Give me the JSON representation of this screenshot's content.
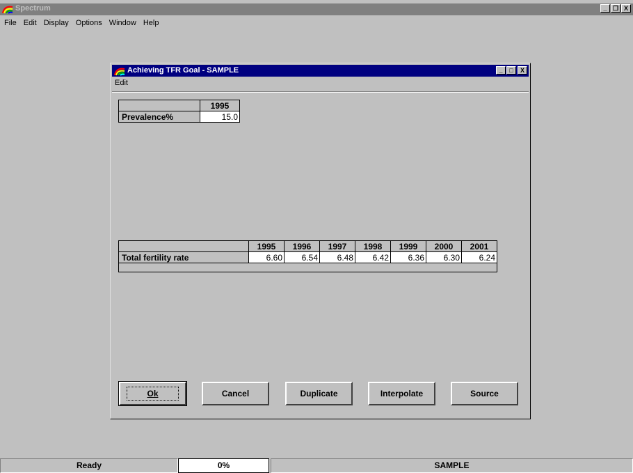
{
  "app": {
    "title": "Spectrum",
    "menu": [
      "File",
      "Edit",
      "Display",
      "Options",
      "Window",
      "Help"
    ],
    "controls": [
      "_",
      "❐",
      "X"
    ]
  },
  "dialog": {
    "title": "Achieving TFR Goal - SAMPLE",
    "menu": "Edit",
    "controls": [
      "_",
      "□",
      "X"
    ],
    "prevalence": {
      "year": "1995",
      "label": "Prevalence%",
      "value": "15.0"
    },
    "tfr": {
      "years": [
        "1995",
        "1996",
        "1997",
        "1998",
        "1999",
        "2000",
        "2001"
      ],
      "label": "Total fertility rate",
      "values": [
        "6.60",
        "6.54",
        "6.48",
        "6.42",
        "6.36",
        "6.30",
        "6.24"
      ]
    },
    "buttons": {
      "ok": "Ok",
      "cancel": "Cancel",
      "duplicate": "Duplicate",
      "interpolate": "Interpolate",
      "source": "Source"
    }
  },
  "status": {
    "state": "Ready",
    "progress": "0%",
    "project": "SAMPLE"
  }
}
